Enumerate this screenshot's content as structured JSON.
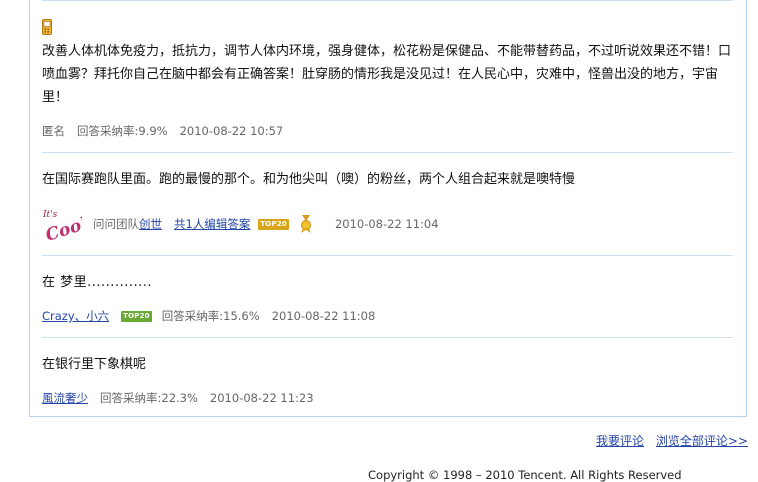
{
  "answers": [
    {
      "text": "改善人体机体免疫力，抵抗力，调节人体内环境，强身健体，松花粉是保健品、不能带替药品，不过听说效果还不错！口喷血雾？拜托你自己在脑中都会有正确答案！肚穿肠的情形我是没见过！在人民心中，灾难中，怪兽出没的地方，宇宙里！",
      "author": "匿名",
      "adoption_rate": "回答采纳率:9.9%",
      "time": "2010-08-22 10:57"
    },
    {
      "text": "在国际赛跑队里面。跑的最慢的那个。和为他尖叫（噢）的粉丝，两个人组合起来就是噢特慢",
      "team_label": "问问团队",
      "author": "创世",
      "edit_link": "共1人编辑答案",
      "badge": "TOP20",
      "time": "2010-08-22 11:04",
      "avatar_text": "It's Cool!"
    },
    {
      "text": "在  梦里..............",
      "author": "Crazy、小六",
      "badge": "TOP20",
      "adoption_rate": "回答采纳率:15.6%",
      "time": "2010-08-22 11:08"
    },
    {
      "text": "在银行里下象棋呢",
      "author": "風流奢少",
      "adoption_rate": "回答采纳率:22.3%",
      "time": "2010-08-22 11:23"
    }
  ],
  "footer": {
    "comment_link": "我要评论",
    "view_all_link": "浏览全部评论>>",
    "copyright": "Copyright © 1998 – 2010 Tencent. All Rights Reserved"
  },
  "colors": {
    "link": "#2545a8",
    "border": "#b6d2ee",
    "badge_gold": "#d8a418",
    "badge_green": "#6aa834"
  }
}
